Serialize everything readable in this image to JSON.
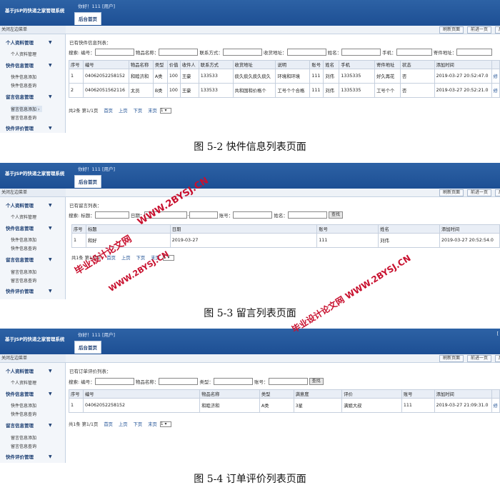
{
  "system_title": "基于JSP的快递之家管理系统",
  "greeting": "你好！111 [用户]",
  "home_tab": "后台首页",
  "top_right": "[",
  "close_menu": "关闭左边菜单",
  "toolbar": {
    "refresh": "刷新页面",
    "back": "前进一页",
    "forward": "后"
  },
  "sidebar": {
    "groups": [
      "个人资料管理",
      "快件信息管理",
      "留言信息管理",
      "快件评价管理"
    ],
    "items": {
      "profile": "个人资料管理",
      "pkg_add": "快件信息添加",
      "pkg_query": "快件信息查询",
      "msg_add": "留言信息添加",
      "msg_query": "留言信息查询"
    }
  },
  "s1": {
    "caption": "已有快件信息列表：",
    "search": {
      "l1": "搜索: 编号：",
      "l2": "物品名称：",
      "l3": "联系方式：",
      "l4": "收货地址：",
      "l5": "姓名：",
      "l6": "手机：",
      "l7": "寄件地址："
    },
    "headers": [
      "序号",
      "编号",
      "物品名称",
      "类型",
      "价值",
      "收件人",
      "联系方式",
      "收货地址",
      "说明",
      "账号",
      "姓名",
      "手机",
      "寄件地址",
      "状态",
      "添加时间",
      ""
    ],
    "rows": [
      [
        "1",
        "04062052258152",
        "和睦济和",
        "A类",
        "100",
        "王豪",
        "133533",
        "痰久痰久痰久痰久",
        "环境和环境",
        "111",
        "刘伟",
        "1335335",
        "好久再花",
        "否",
        "2019-03-27 20:52:47.0",
        "修"
      ],
      [
        "2",
        "04062051562116",
        "太员",
        "B类",
        "100",
        "王豪",
        "133533",
        "共和国和价格个",
        "工号个个合格",
        "111",
        "刘伟",
        "1335335",
        "工号个个",
        "否",
        "2019-03-27 20:52:21.0",
        "修"
      ]
    ],
    "pager": {
      "info": "共2条 第1/1页",
      "first": "首页",
      "prev": "上页",
      "next": "下页",
      "last": "末页",
      "page": "1"
    },
    "figure": "图 5-2 快件信息列表页面"
  },
  "s2": {
    "caption": "已有留言列表：",
    "search": {
      "l1": "搜索: 标题：",
      "l2": "日期：",
      "l3": "账号：",
      "l4": "姓名：",
      "btn": "查找"
    },
    "headers": [
      "序号",
      "标题",
      "日期",
      "账号",
      "姓名",
      "添加时间"
    ],
    "rows": [
      [
        "1",
        "和好",
        "2019-03-27",
        "111",
        "刘伟",
        "2019-03-27 20:52:54.0"
      ]
    ],
    "pager": {
      "info": "共1条 第1/1页",
      "first": "首页",
      "prev": "上页",
      "next": "下页",
      "last": "末页",
      "page": "1"
    },
    "figure": "图 5-3 留言列表页面"
  },
  "s3": {
    "caption": "已有订单评价列表：",
    "search": {
      "l1": "搜索: 编号：",
      "l2": "物品名称：",
      "l3": "类型：",
      "l4": "账号：",
      "btn": "查找"
    },
    "headers": [
      "序号",
      "编号",
      "物品名称",
      "类型",
      "满意度",
      "评价",
      "账号",
      "添加时间",
      ""
    ],
    "rows": [
      [
        "1",
        "04062052258152",
        "和睦济和",
        "A类",
        "3星",
        "满姐大叔",
        "111",
        "2019-03-27 21:09:31.0",
        "修"
      ]
    ],
    "pager": {
      "info": "共1条 第1/1页",
      "first": "首页",
      "prev": "上页",
      "next": "下页",
      "last": "末页",
      "page": "1"
    },
    "figure": "图 5-4 订单评价列表页面"
  },
  "watermarks": {
    "w1": "WWW.2BYSJ.CN",
    "w2": "毕业设计论文网",
    "w3": "WWW.2BYSJ.CN",
    "w4": "毕业设计论文网 WWW.2BYSJ.CN"
  },
  "colors": {
    "header": "#2d62a5",
    "accent": "#1d3f73",
    "watermark": "#c8102e"
  }
}
